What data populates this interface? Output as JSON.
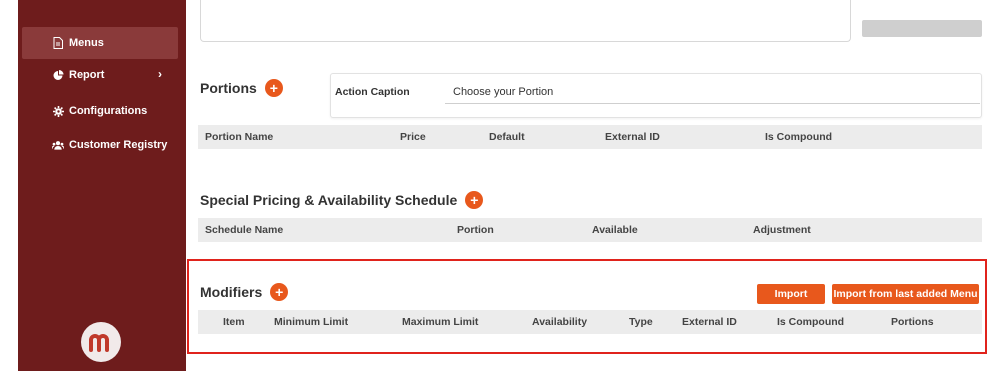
{
  "sidebar": {
    "items": [
      {
        "label": "Menus",
        "icon": "document-icon"
      },
      {
        "label": "Report",
        "icon": "pie-chart-icon"
      },
      {
        "label": "Configurations",
        "icon": "gear-icon"
      },
      {
        "label": "Customer Registry",
        "icon": "users-icon"
      }
    ],
    "logo_letter": "m"
  },
  "portions": {
    "title": "Portions",
    "action_caption_label": "Action Caption",
    "action_caption_value": "Choose your Portion",
    "columns": [
      "Portion Name",
      "Price",
      "Default",
      "External ID",
      "Is Compound"
    ]
  },
  "schedule": {
    "title": "Special Pricing & Availability Schedule",
    "columns": [
      "Schedule Name",
      "Portion",
      "Available",
      "Adjustment"
    ]
  },
  "modifiers": {
    "title": "Modifiers",
    "import_label": "Import",
    "import_last_label": "Import from last added Menu",
    "columns": [
      "Item",
      "Minimum Limit",
      "Maximum Limit",
      "Availability",
      "Type",
      "External ID",
      "Is Compound",
      "Portions"
    ]
  },
  "colors": {
    "accent": "#e8581c",
    "sidebar": "#6e1c1c",
    "highlight": "#e0231c"
  }
}
